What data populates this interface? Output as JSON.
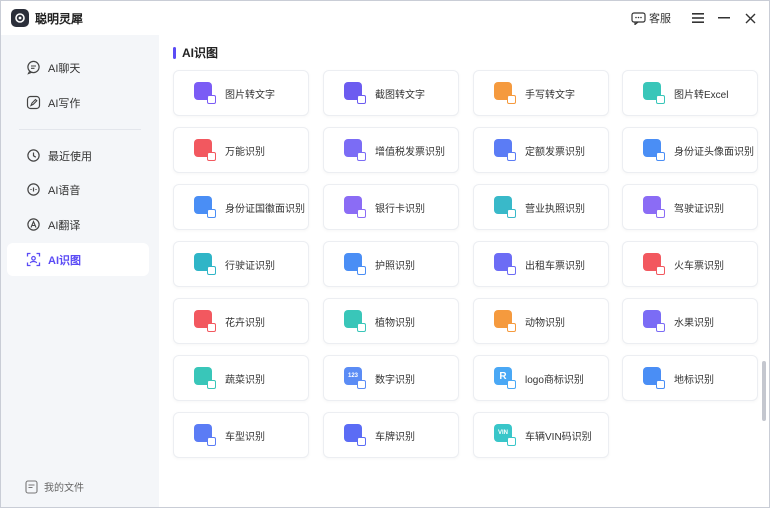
{
  "app": {
    "title": "聪明灵犀"
  },
  "titlebar": {
    "service_label": "客服"
  },
  "sidebar": {
    "items": [
      {
        "label": "AI聊天",
        "icon": "chat-icon"
      },
      {
        "label": "AI写作",
        "icon": "pen-icon"
      },
      {
        "label": "最近使用",
        "icon": "history-icon"
      },
      {
        "label": "AI语音",
        "icon": "voice-icon"
      },
      {
        "label": "AI翻译",
        "icon": "translate-icon"
      },
      {
        "label": "AI识图",
        "icon": "scan-icon"
      }
    ],
    "footer_label": "我的文件"
  },
  "main": {
    "section_title": "AI识图",
    "cards": [
      {
        "label": "图片转文字",
        "color": "#7b5cf5",
        "glyph": ""
      },
      {
        "label": "截图转文字",
        "color": "#6c5cf0",
        "glyph": ""
      },
      {
        "label": "手写转文字",
        "color": "#f59a3e",
        "glyph": ""
      },
      {
        "label": "图片转Excel",
        "color": "#39c6b9",
        "glyph": ""
      },
      {
        "label": "万能识别",
        "color": "#f2585f",
        "glyph": ""
      },
      {
        "label": "增值税发票识别",
        "color": "#7b6cf5",
        "glyph": ""
      },
      {
        "label": "定额发票识别",
        "color": "#5b7cf5",
        "glyph": ""
      },
      {
        "label": "身份证头像面识别",
        "color": "#4a8ef5",
        "glyph": ""
      },
      {
        "label": "身份证国徽面识别",
        "color": "#4a8ef5",
        "glyph": ""
      },
      {
        "label": "银行卡识别",
        "color": "#8b6cf5",
        "glyph": ""
      },
      {
        "label": "营业执照识别",
        "color": "#39b9c9",
        "glyph": ""
      },
      {
        "label": "驾驶证识别",
        "color": "#8b6cf5",
        "glyph": ""
      },
      {
        "label": "行驶证识别",
        "color": "#2fb5c7",
        "glyph": ""
      },
      {
        "label": "护照识别",
        "color": "#4a8ef5",
        "glyph": ""
      },
      {
        "label": "出租车票识别",
        "color": "#6c6cf5",
        "glyph": ""
      },
      {
        "label": "火车票识别",
        "color": "#f2585f",
        "glyph": ""
      },
      {
        "label": "花卉识别",
        "color": "#f2585f",
        "glyph": ""
      },
      {
        "label": "植物识别",
        "color": "#39c6b9",
        "glyph": ""
      },
      {
        "label": "动物识别",
        "color": "#f59a3e",
        "glyph": ""
      },
      {
        "label": "水果识别",
        "color": "#7b6cf5",
        "glyph": ""
      },
      {
        "label": "蔬菜识别",
        "color": "#39c6b9",
        "glyph": ""
      },
      {
        "label": "数字识别",
        "color": "#5b8cf5",
        "glyph": "123"
      },
      {
        "label": "logo商标识别",
        "color": "#4aa8f5",
        "glyph": "R"
      },
      {
        "label": "地标识别",
        "color": "#4a8ef5",
        "glyph": ""
      },
      {
        "label": "车型识别",
        "color": "#5b7cf5",
        "glyph": ""
      },
      {
        "label": "车牌识别",
        "color": "#5b6cf5",
        "glyph": ""
      },
      {
        "label": "车辆VIN码识别",
        "color": "#39c6c9",
        "glyph": "VIN"
      }
    ]
  }
}
